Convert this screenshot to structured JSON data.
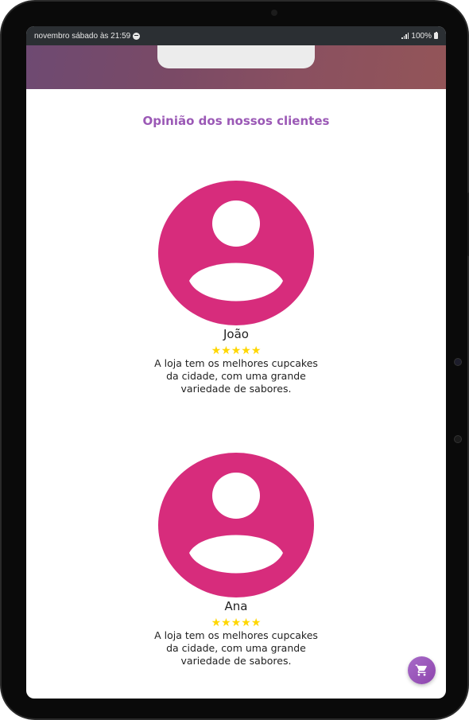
{
  "status_bar": {
    "time_text": "novembro sábado às 21:59",
    "battery_text": "100%"
  },
  "section": {
    "title": "Opinião dos nossos clientes"
  },
  "testimonials": [
    {
      "name": "João",
      "rating": 5,
      "stars": "★★★★★",
      "text": "A loja tem os melhores cupcakes da cidade, com uma grande variedade de sabores."
    },
    {
      "name": "Ana",
      "rating": 5,
      "stars": "★★★★★",
      "text": "A loja tem os melhores cupcakes da cidade, com uma grande variedade de sabores."
    }
  ],
  "cart_button": {
    "icon": "shopping-cart-icon"
  },
  "colors": {
    "accent": "#9b59b6",
    "avatar": "#d72c7c",
    "stars": "#ffd700"
  }
}
